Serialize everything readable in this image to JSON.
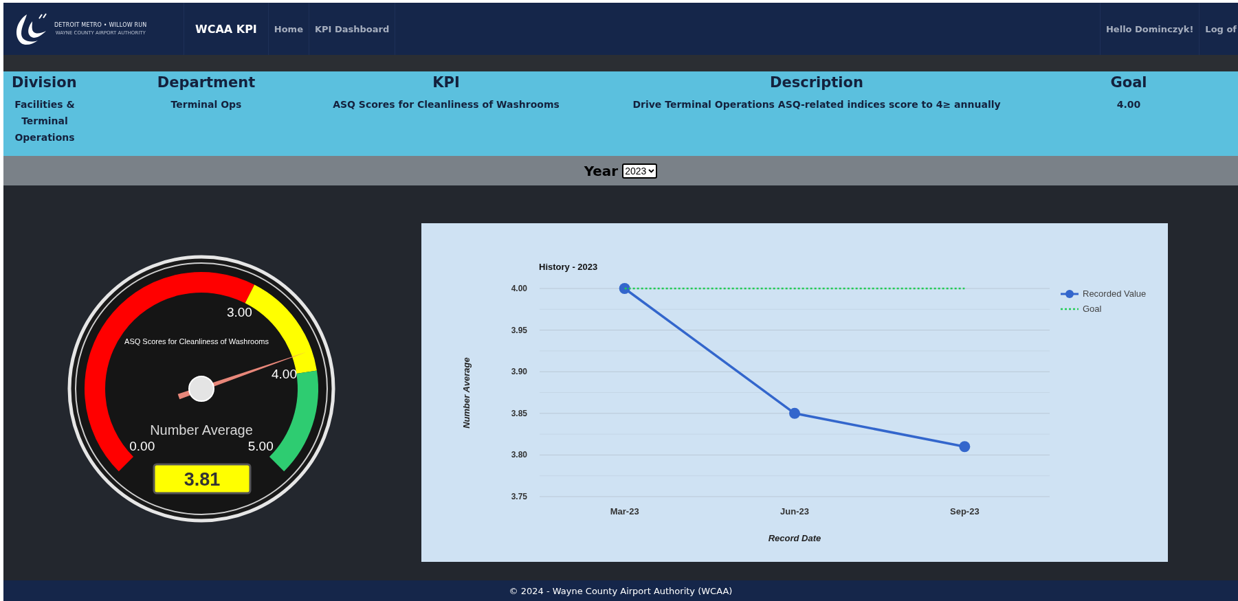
{
  "header": {
    "logo_line1": "DETROIT METRO • WILLOW RUN",
    "logo_line2": "WAYNE COUNTY AIRPORT AUTHORITY",
    "brand": "WCAA KPI",
    "nav": [
      "Home",
      "KPI Dashboard"
    ],
    "greeting": "Hello Dominczyk!",
    "logout": "Log of"
  },
  "info": {
    "columns": [
      {
        "heading": "Division",
        "value": "Facilities & Terminal Operations"
      },
      {
        "heading": "Department",
        "value": "Terminal Ops"
      },
      {
        "heading": "KPI",
        "value": "ASQ Scores for Cleanliness of Washrooms"
      },
      {
        "heading": "Description",
        "value": "Drive Terminal Operations ASQ-related indices score to 4≥ annually"
      },
      {
        "heading": "Goal",
        "value": "4.00"
      }
    ]
  },
  "year": {
    "label": "Year",
    "value": "2023"
  },
  "gauge": {
    "title": "ASQ Scores for Cleanliness of Washrooms",
    "unit_label": "Number Average",
    "value": "3.81",
    "bands": [
      {
        "color": "#ff0000"
      },
      {
        "color": "#ffff00"
      },
      {
        "color": "#2ecc71"
      }
    ],
    "ticks": [
      "0.00",
      "3.00",
      "4.00",
      "5.00"
    ]
  },
  "chart": {
    "chart_data": {
      "type": "line",
      "title": "History - 2023",
      "xlabel": "Record Date",
      "ylabel": "Number Average",
      "categories": [
        "Mar-23",
        "Jun-23",
        "Sep-23"
      ],
      "grid": true,
      "legend": true,
      "series": [
        {
          "name": "Recorded Value",
          "color": "#3366cc",
          "marker": "circle",
          "values": [
            4.0,
            3.85,
            3.81
          ]
        },
        {
          "name": "Goal",
          "color": "#22cc55",
          "line_style": "dashed",
          "values": [
            4.0,
            4.0,
            4.0
          ]
        }
      ],
      "ylim": [
        3.75,
        4.0
      ],
      "yticks": [
        {
          "value": 3.75,
          "label": "3.75"
        },
        {
          "value": 3.8,
          "label": "3.80"
        },
        {
          "value": 3.85,
          "label": "3.85"
        },
        {
          "value": 3.9,
          "label": "3.90"
        },
        {
          "value": 3.95,
          "label": "3.95"
        },
        {
          "value": 4.0,
          "label": "4.00"
        }
      ]
    }
  },
  "footer": "© 2024 - Wayne County Airport Authority (WCAA)"
}
